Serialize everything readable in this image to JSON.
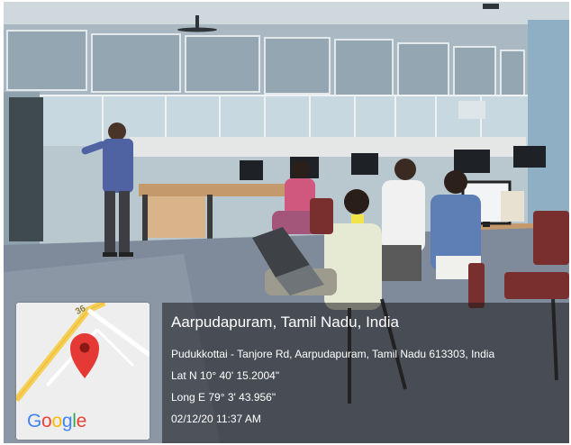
{
  "geotag": {
    "place_title": "Aarpudapuram, Tamil Nadu, India",
    "address": "Pudukkottai - Tanjore Rd, Aarpudapuram, Tamil Nadu 613303, India",
    "latitude": "Lat N 10° 40' 15.2004\"",
    "longitude": "Long E 79° 3' 43.956\"",
    "timestamp": "02/12/20 11:37 AM"
  },
  "map": {
    "road_number": "36",
    "logo_letters": [
      "G",
      "o",
      "o",
      "g",
      "l",
      "e"
    ],
    "pin_icon": "map-pin-icon",
    "pin_color": "#e53935"
  },
  "colors": {
    "overlay": "rgba(28,28,30,0.55)",
    "wall": "#b9c7cf",
    "floor": "#7f8a9a"
  }
}
